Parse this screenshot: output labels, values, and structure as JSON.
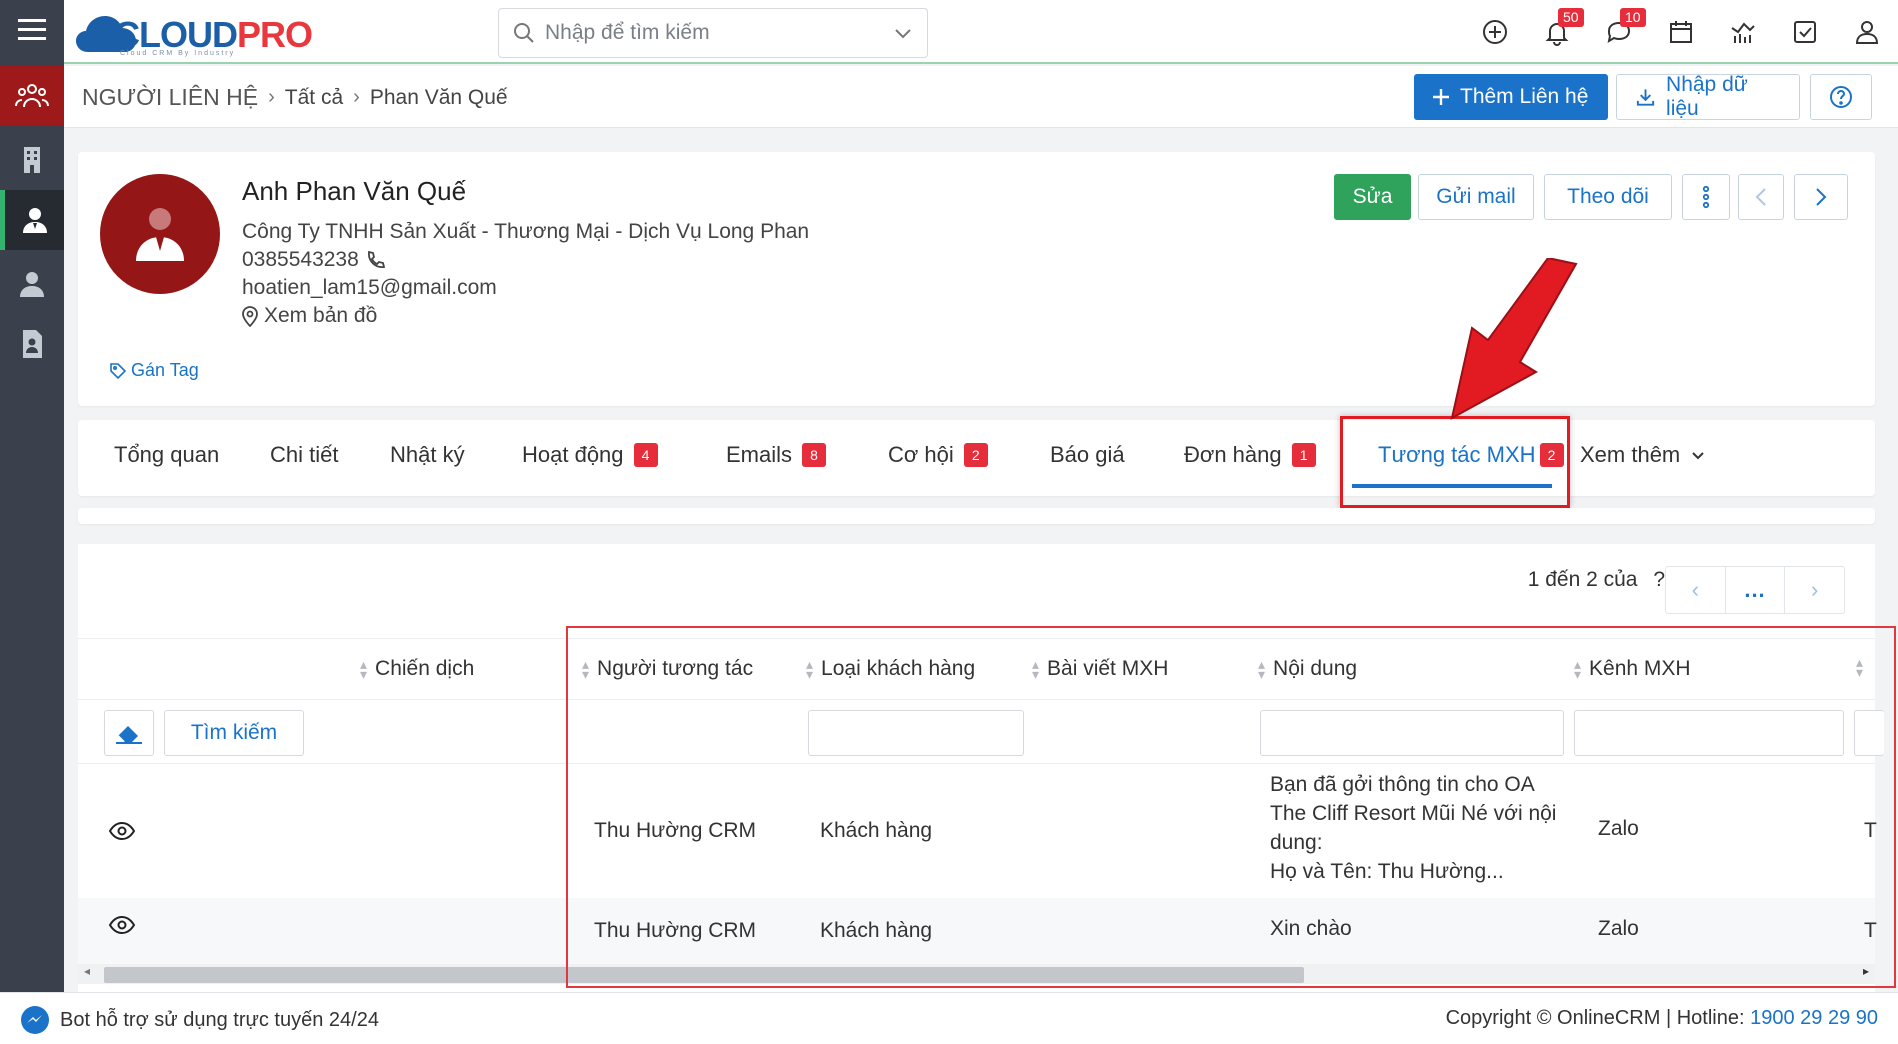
{
  "app": {
    "brand_main": "CLOUD",
    "brand_accent": "PRO",
    "brand_sub": "Cloud CRM By Industry",
    "accent_color": "#1a73c9",
    "brand_red": "#e8383d"
  },
  "search": {
    "placeholder": "Nhập để tìm kiếm"
  },
  "notifications": {
    "bell_count": "50",
    "chat_count": "10"
  },
  "breadcrumb": {
    "root": "NGƯỜI LIÊN HỆ",
    "level1": "Tất cả",
    "level2": "Phan Văn Quế"
  },
  "header_actions": {
    "add_contact": "Thêm Liên hệ",
    "import": "Nhập dữ liệu"
  },
  "profile": {
    "name": "Anh Phan Văn Quế",
    "company": "Công Ty TNHH Sản Xuất - Thương Mại - Dịch Vụ Long Phan",
    "phone": "0385543238",
    "email": "hoatien_lam15@gmail.com",
    "map_link": "Xem bản đồ",
    "tag_link": "Gán Tag"
  },
  "profile_actions": {
    "edit": "Sửa",
    "send_mail": "Gửi mail",
    "follow": "Theo dõi"
  },
  "tabs": [
    {
      "label": "Tổng quan",
      "count": ""
    },
    {
      "label": "Chi tiết",
      "count": ""
    },
    {
      "label": "Nhật ký",
      "count": ""
    },
    {
      "label": "Hoạt động",
      "count": "4"
    },
    {
      "label": "Emails",
      "count": "8"
    },
    {
      "label": "Cơ hội",
      "count": "2"
    },
    {
      "label": "Báo giá",
      "count": ""
    },
    {
      "label": "Đơn hàng",
      "count": "1"
    },
    {
      "label": "Tương tác MXH",
      "count": "2"
    },
    {
      "label": "Xem thêm",
      "count": ""
    }
  ],
  "pagination": {
    "summary": "1 đến 2 của",
    "unknown": "?",
    "ellipsis": "..."
  },
  "table": {
    "columns": [
      "Chiến dịch",
      "Người tương tác",
      "Loại khách hàng",
      "Bài viết MXH",
      "Nội dung",
      "Kênh MXH"
    ],
    "search_button": "Tìm kiếm",
    "rows": [
      {
        "interactor": "Thu Hường CRM",
        "customer_type": "Khách hàng",
        "content_lines": [
          "Bạn đã gởi thông tin cho OA",
          "The Cliff Resort Mũi Né với nội",
          "dung:",
          "Họ và Tên: Thu Hường..."
        ],
        "channel": "Zalo",
        "overflow": "T"
      },
      {
        "interactor": "Thu Hường CRM",
        "customer_type": "Khách hàng",
        "content_lines": [
          "Xin chào"
        ],
        "channel": "Zalo",
        "overflow": "T"
      }
    ]
  },
  "footer": {
    "bot": "Bot hỗ trợ sử dụng trực tuyến 24/24",
    "copyright": "Copyright © OnlineCRM | Hotline: ",
    "hotline": "1900 29 29 90"
  }
}
